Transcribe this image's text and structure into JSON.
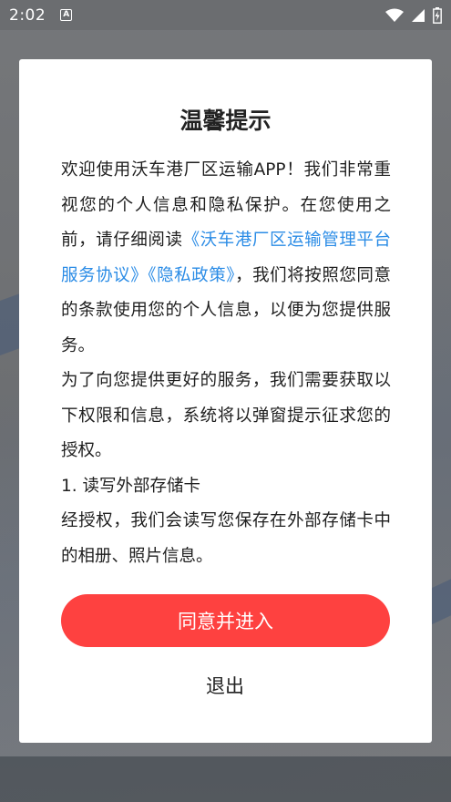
{
  "status_bar": {
    "time": "2:02",
    "notification_glyph": "A",
    "icons": [
      "wifi-icon",
      "signal-icon",
      "battery-charging-icon"
    ]
  },
  "dialog": {
    "title": "温馨提示",
    "paragraph1_prefix": "欢迎使用沃车港厂区运输APP！我们非常重视您的个人信息和隐私保护。在您使用之前，请仔细阅读",
    "service_agreement_link": "《沃车港厂区运输管理平台服务协议》",
    "privacy_policy_link": "《隐私政策》",
    "paragraph1_suffix": "，我们将按照您同意的条款使用您的个人信息，以便为您提供服务。",
    "paragraph2": "为了向您提供更好的服务，我们需要获取以下权限和信息，系统将以弹窗提示征求您的授权。",
    "permission1_title": "1. 读写外部存储卡",
    "permission1_desc": "经授权，我们会读写您保存在外部存储卡中的相册、照片信息。",
    "agree_label": "同意并进入",
    "exit_label": "退出"
  },
  "colors": {
    "accent_button": "#fe4140",
    "link": "#2b8ce6",
    "overlay": "#6f7276"
  }
}
